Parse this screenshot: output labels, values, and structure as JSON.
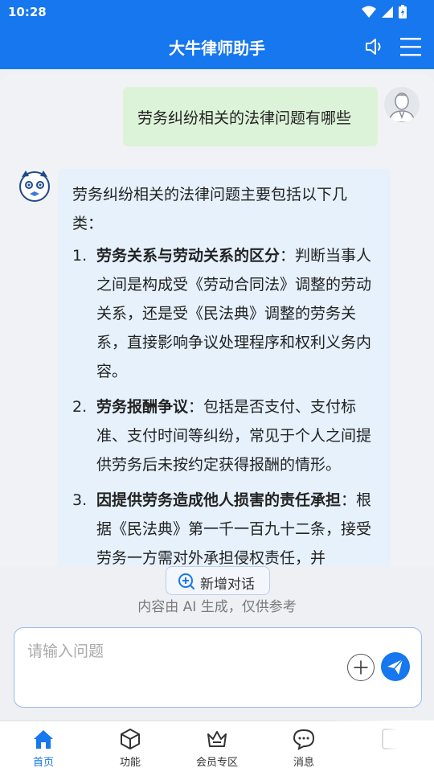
{
  "status_bar": {
    "time": "10:28"
  },
  "header": {
    "title": "大牛律师助手",
    "speaker_icon": "speaker-icon",
    "menu_icon": "menu-icon"
  },
  "chat": {
    "user_message": "劳务纠纷相关的法律问题有哪些",
    "bot_intro": "劳务纠纷相关的法律问题主要包括以下几类：",
    "bot_items": [
      {
        "num": "1.",
        "title": "劳务关系与劳动关系的区分",
        "text": "：判断当事人之间是构成受《劳动合同法》调整的劳动关系，还是受《民法典》调整的劳务关系，直接影响争议处理程序和权利义务内容。"
      },
      {
        "num": "2.",
        "title": "劳务报酬争议",
        "text": "：包括是否支付、支付标准、支付时间等纠纷，常见于个人之间提供劳务后未按约定获得报酬的情形。"
      },
      {
        "num": "3.",
        "title": "因提供劳务造成他人损害的责任承担",
        "text": "：根据《民法典》第一千一百九十二条，接受劳务一方需对外承担侵权责任，并"
      }
    ]
  },
  "new_chat_label": "新增对话",
  "disclaimer": "内容由 AI 生成，仅供参考",
  "input": {
    "placeholder": "请输入问题"
  },
  "tabs": [
    {
      "label": "首页",
      "icon": "home-icon",
      "active": true
    },
    {
      "label": "功能",
      "icon": "cube-icon",
      "active": false
    },
    {
      "label": "会员专区",
      "icon": "crown-icon",
      "active": false
    },
    {
      "label": "消息",
      "icon": "chat-icon",
      "active": false
    },
    {
      "label": "",
      "icon": "profile-icon",
      "active": false
    }
  ],
  "colors": {
    "primary": "#1677ee",
    "user_bubble": "#ddf3d9",
    "bot_bubble": "#e6f1fc"
  }
}
